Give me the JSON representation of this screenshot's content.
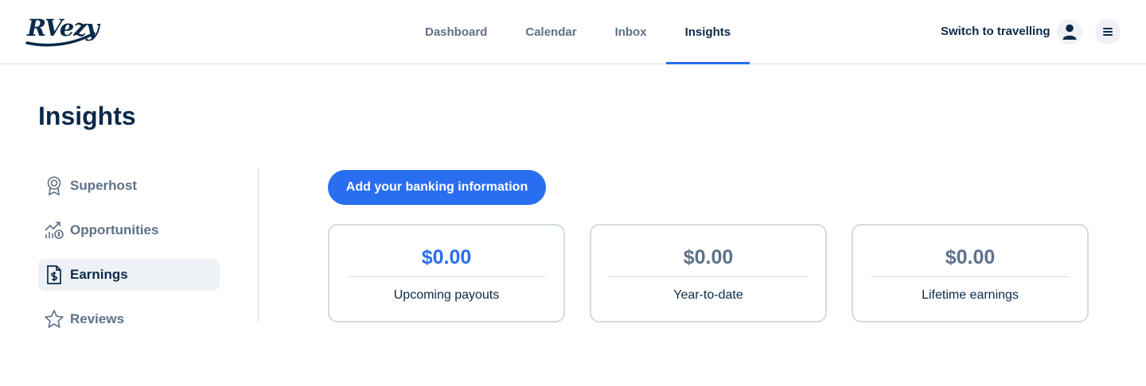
{
  "header": {
    "logo_text": "RVezy",
    "nav": [
      {
        "label": "Dashboard",
        "active": false
      },
      {
        "label": "Calendar",
        "active": false
      },
      {
        "label": "Inbox",
        "active": false
      },
      {
        "label": "Insights",
        "active": true
      }
    ],
    "switch_label": "Switch to travelling",
    "avatar_icon": "user-icon",
    "menu_icon": "hamburger-icon"
  },
  "page": {
    "title": "Insights"
  },
  "sidebar": {
    "items": [
      {
        "label": "Superhost",
        "icon": "award-badge-icon",
        "active": false
      },
      {
        "label": "Opportunities",
        "icon": "growth-chart-icon",
        "active": false
      },
      {
        "label": "Earnings",
        "icon": "receipt-dollar-icon",
        "active": true
      },
      {
        "label": "Reviews",
        "icon": "star-icon",
        "active": false
      }
    ]
  },
  "main": {
    "bank_button_label": "Add your banking information",
    "cards": [
      {
        "amount": "$0.00",
        "label": "Upcoming payouts",
        "highlight": true
      },
      {
        "amount": "$0.00",
        "label": "Year-to-date",
        "highlight": false
      },
      {
        "amount": "$0.00",
        "label": "Lifetime earnings",
        "highlight": false
      }
    ]
  },
  "colors": {
    "accent": "#2a6ef0",
    "navy": "#0b2a4a",
    "muted": "#5e7189",
    "border": "#d3dae3"
  }
}
